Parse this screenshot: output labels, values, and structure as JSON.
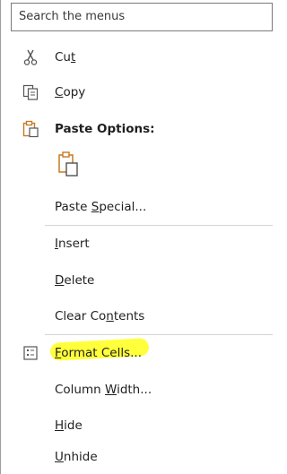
{
  "search": {
    "placeholder": "Search the menus"
  },
  "items": {
    "cut": {
      "pre": "Cu",
      "key": "t",
      "post": ""
    },
    "copy": {
      "pre": "",
      "key": "C",
      "post": "opy"
    },
    "paste_options": {
      "label": "Paste Options:"
    },
    "paste_special": {
      "pre": "Paste ",
      "key": "S",
      "post": "pecial..."
    },
    "insert": {
      "pre": "",
      "key": "I",
      "post": "nsert"
    },
    "delete": {
      "pre": "",
      "key": "D",
      "post": "elete"
    },
    "clear_contents": {
      "pre": "Clear Co",
      "key": "n",
      "post": "tents"
    },
    "format_cells": {
      "pre": "",
      "key": "F",
      "post": "ormat Cells..."
    },
    "column_width": {
      "pre": "Column ",
      "key": "W",
      "post": "idth..."
    },
    "hide": {
      "pre": "",
      "key": "H",
      "post": "ide"
    },
    "unhide": {
      "pre": "",
      "key": "U",
      "post": "nhide"
    }
  },
  "colors": {
    "highlight": "#ffff3b",
    "paste_icon_accent": "#c8781e",
    "text": "#1f1f1f"
  },
  "icons": {
    "cut": "scissors-icon",
    "copy": "copy-icon",
    "paste_options": "clipboard-icon",
    "paste_option_keep": "clipboard-icon",
    "format_cells": "format-cells-icon"
  }
}
